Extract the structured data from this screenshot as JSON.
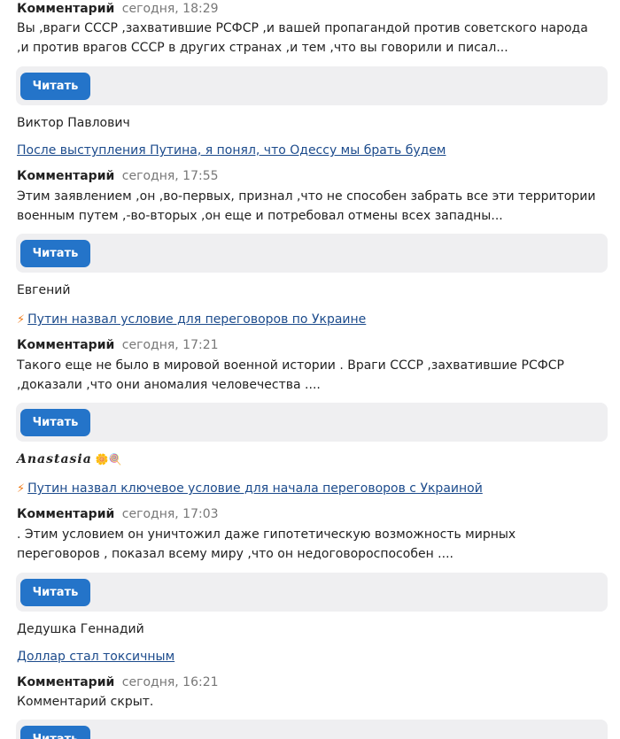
{
  "feed": {
    "entry0": {
      "meta_label": "Комментарий",
      "time": "сегодня, 18:29",
      "text": "Вы ,враги СССР ,захватившие РСФСР ,и вашей пропагандой против советского народа ,и против врагов СССР в других странах ,и тем ,что вы говорили и писал...",
      "button": "Читать"
    },
    "entry1": {
      "author": "Виктор Павлович",
      "link": "После выступления Путина, я понял, что Одессу мы брать будем",
      "meta_label": "Комментарий",
      "time": "сегодня, 17:55",
      "text": "Этим заявлением ,он ,во-первых, признал ,что не способен забрать все эти территории военным путем ,-во-вторых ,он еще и потребовал отмены всех западны...",
      "button": "Читать"
    },
    "entry2": {
      "author": "Евгений",
      "link_icon": "⚡",
      "link": "Путин назвал условие для переговоров по Украине",
      "meta_label": "Комментарий",
      "time": "сегодня, 17:21",
      "text": "Такого еще не было в мировой военной истории . Враги СССР ,захватившие РСФСР ,доказали ,что они аномалия человечества ....",
      "button": "Читать"
    },
    "entry3": {
      "author": "Anastasia",
      "author_emoji": "🌼🍭",
      "link_icon": "⚡",
      "link": "Путин назвал ключевое условие для начала переговоров с Украиной",
      "meta_label": "Комментарий",
      "time": "сегодня, 17:03",
      "text": ". Этим условием он уничтожил даже гипотетическую возможность мирных переговоров , показал всему миру ,что он недоговороспособен ....",
      "button": "Читать"
    },
    "entry4": {
      "author": "Дедушка Геннадий",
      "link": "Доллар стал токсичным",
      "meta_label": "Комментарий",
      "time": "сегодня, 16:21",
      "text": "Комментарий скрыт.",
      "button": "Читать"
    }
  },
  "colors": {
    "button_bg": "#2474c9",
    "link": "#1c4b8c",
    "bar_bg": "#efeff1",
    "lightning": "#f07c1a"
  }
}
